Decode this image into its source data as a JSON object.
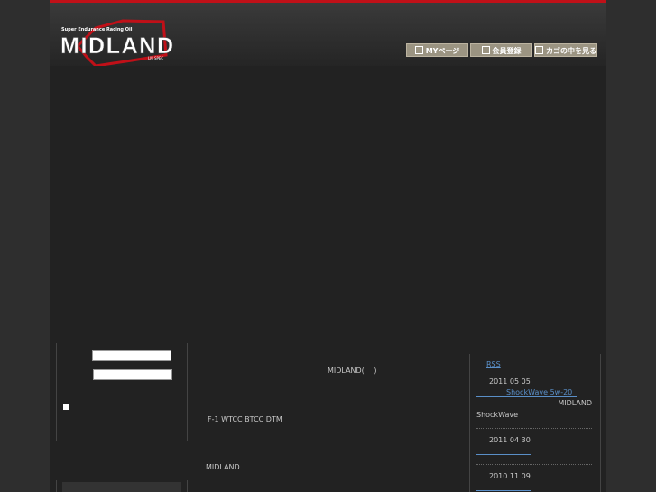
{
  "header": {
    "logo_tagline": "Super Endurance Racing Oil",
    "logo_text": "MIDLAND",
    "logo_sub": "LM SPEC",
    "buttons": [
      {
        "label": "MYページ",
        "icon": "m-icon"
      },
      {
        "label": "会員登録",
        "icon": "person-icon"
      },
      {
        "label": "カゴの中を見る",
        "icon": "cart-icon"
      }
    ]
  },
  "main": {
    "line1": "MIDLAND(　 )",
    "line2": "F-1 WTCC BTCC DTM",
    "line3": "MIDLAND"
  },
  "sidebar_right": {
    "rss": "RSS",
    "entries": [
      {
        "date": "2011 05 05",
        "link": "ShockWave 5w-20",
        "text1": "MIDLAND",
        "text2": "ShockWave"
      },
      {
        "date": "2011 04 30"
      },
      {
        "date": "2010 11 09"
      }
    ]
  },
  "colors": {
    "accent": "#c01018",
    "link": "#5a8fc8"
  }
}
